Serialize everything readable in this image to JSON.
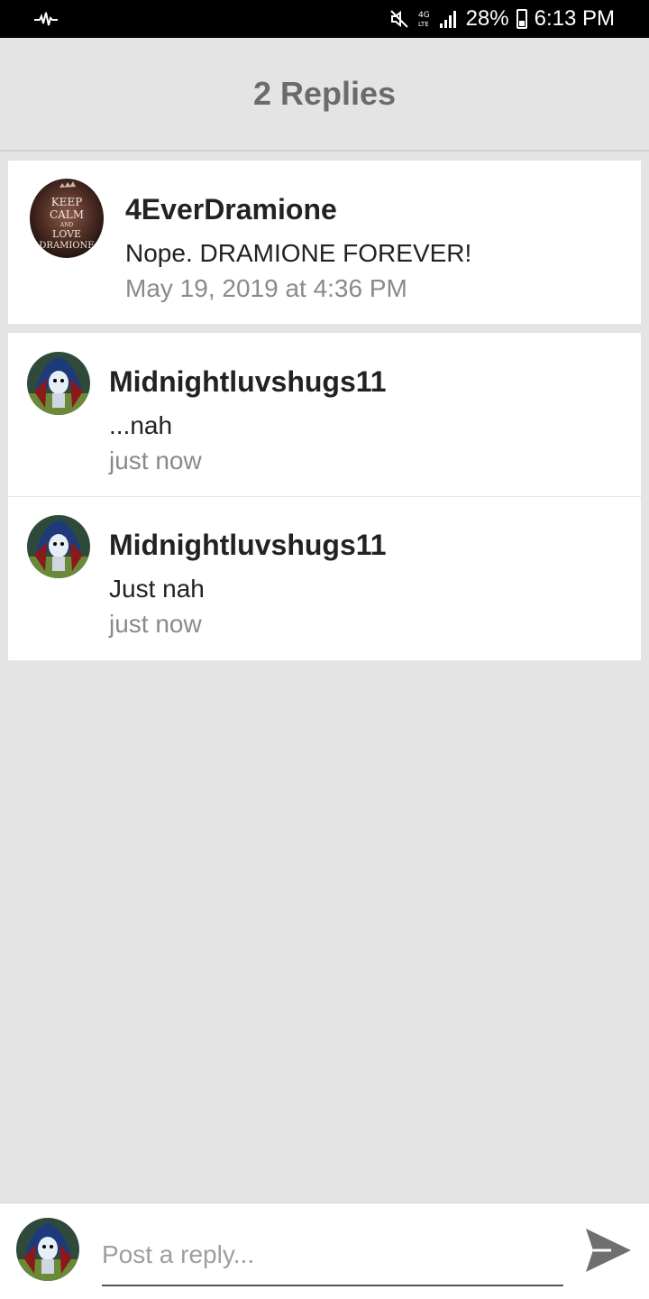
{
  "status_bar": {
    "battery_percent": "28%",
    "time": "6:13 PM",
    "network": "4G LTE"
  },
  "header": {
    "title": "2 Replies"
  },
  "replies": [
    {
      "username": "4EverDramione",
      "text": "Nope. DRAMIONE FOREVER!",
      "time": "May 19, 2019 at 4:36 PM",
      "avatar_text": [
        "KEEP",
        "CALM",
        "AND",
        "LOVE",
        "DRAMIONE"
      ]
    },
    {
      "username": "Midnightluvshugs11",
      "text": "...nah",
      "time": "just now"
    },
    {
      "username": "Midnightluvshugs11",
      "text": "Just nah",
      "time": "just now"
    }
  ],
  "composer": {
    "placeholder": "Post a reply...",
    "value": ""
  },
  "icons": {
    "activity": "waveform-icon",
    "mute": "mute-icon",
    "signal": "signal-icon",
    "battery": "battery-icon",
    "send": "send-icon"
  },
  "colors": {
    "background": "#e4e4e4",
    "card": "#ffffff",
    "title": "#6b6b6b",
    "timestamp": "#8a8a8a",
    "send_icon": "#6f6f6f"
  }
}
